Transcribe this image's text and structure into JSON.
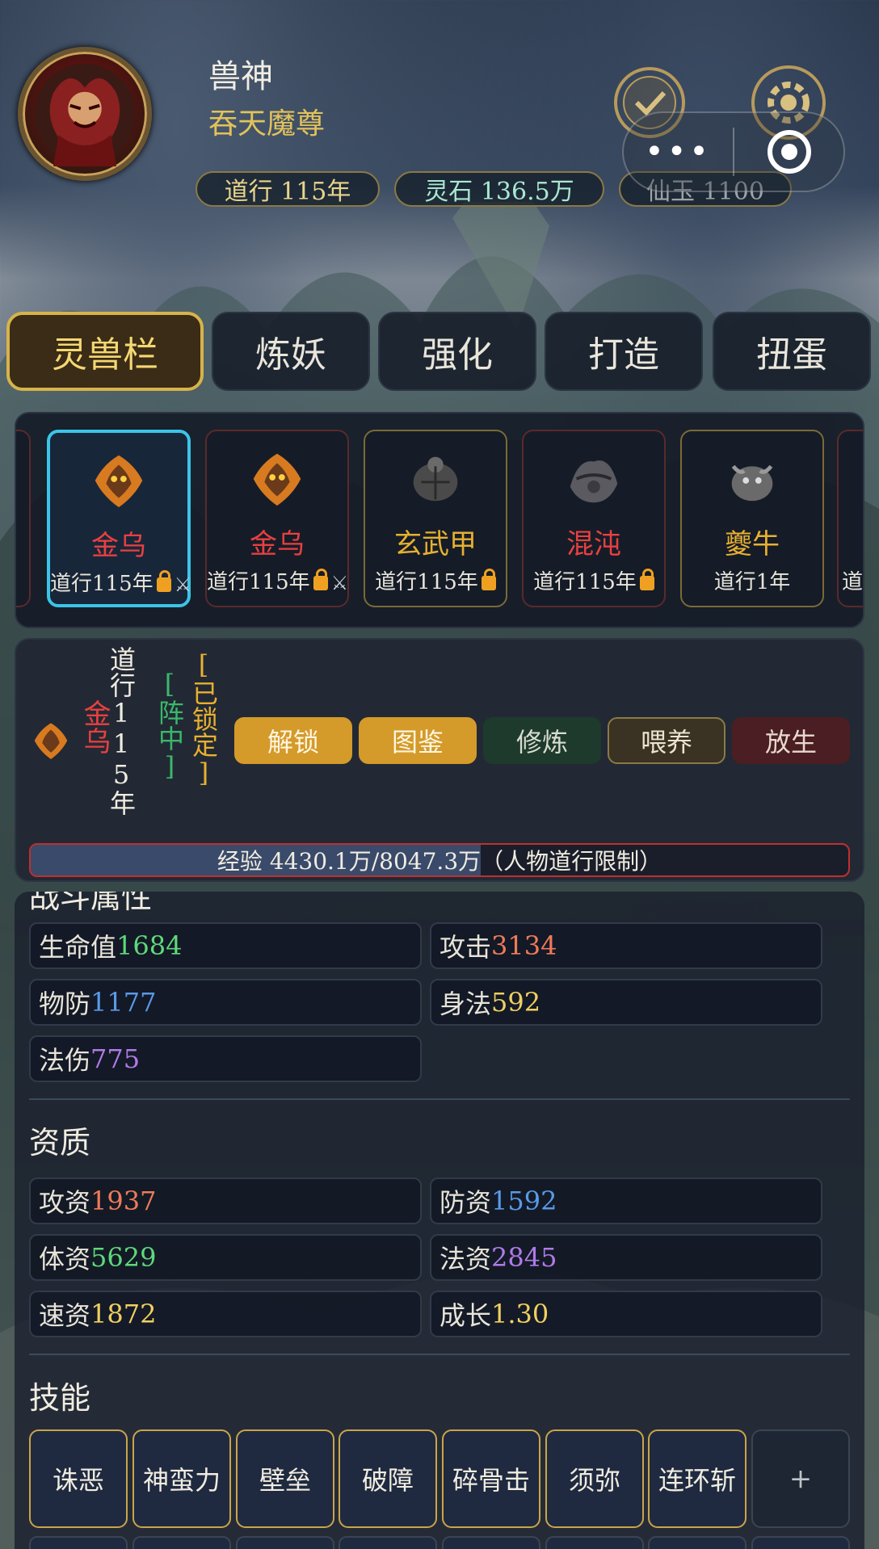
{
  "header": {
    "name": "兽神",
    "title": "吞天魔尊",
    "stats": [
      {
        "label": "道行 115年",
        "color": "#e8d48a"
      },
      {
        "label": "灵石 136.5万",
        "color": "#a8e8d0"
      },
      {
        "label": "仙玉 1100",
        "color": "#a0a4a8"
      }
    ],
    "icons": [
      "sign-in-icon",
      "settings-icon"
    ],
    "capsule": {
      "more_label": "•••",
      "close_label": "◉"
    }
  },
  "tabs": [
    {
      "label": "灵兽栏",
      "active": true
    },
    {
      "label": "炼妖",
      "active": false
    },
    {
      "label": "强化",
      "active": false
    },
    {
      "label": "打造",
      "active": false
    },
    {
      "label": "扭蛋",
      "active": false
    }
  ],
  "pets": [
    {
      "name": "金乌",
      "info": "道行115年",
      "locked": true,
      "battle": true,
      "name_color": "#e84040",
      "selected": true
    },
    {
      "name": "金乌",
      "info": "道行115年",
      "locked": true,
      "battle": true,
      "name_color": "#e84040",
      "selected": false
    },
    {
      "name": "玄武甲",
      "info": "道行115年",
      "locked": true,
      "battle": false,
      "name_color": "#e8b030",
      "selected": false
    },
    {
      "name": "混沌",
      "info": "道行115年",
      "locked": true,
      "battle": false,
      "name_color": "#e84040",
      "selected": false
    },
    {
      "name": "夔牛",
      "info": "道行1年",
      "locked": false,
      "battle": false,
      "name_color": "#e8b030",
      "selected": false
    },
    {
      "name": "",
      "info": "道行",
      "locked": false,
      "battle": false,
      "name_color": "#e8b030",
      "selected": false
    }
  ],
  "detail": {
    "name": "金乌",
    "dao": "道行115年",
    "formation": "[阵中]",
    "lock_state": "[已锁定]",
    "buttons": [
      {
        "label": "解锁",
        "bg": "#d49a2a",
        "fg": "#fff6e0"
      },
      {
        "label": "图鉴",
        "bg": "#d49a2a",
        "fg": "#fff6e0"
      },
      {
        "label": "修炼",
        "bg": "#1e3a2c",
        "fg": "#d8dcd0"
      },
      {
        "label": "喂养",
        "bg": "#3a3222",
        "fg": "#ece4d0"
      },
      {
        "label": "放生",
        "bg": "#4a1e22",
        "fg": "#e8d8d0"
      }
    ],
    "exp_text": "经验 4430.1万/8047.3万（人物道行限制）",
    "exp_progress": 0.55
  },
  "battle_attrs": {
    "title": "战斗属性",
    "items": [
      {
        "label": "生命值",
        "value": "1684",
        "color": "#5fd87a"
      },
      {
        "label": "攻击",
        "value": "3134",
        "color": "#f07a5a"
      },
      {
        "label": "物防",
        "value": "1177",
        "color": "#5a9ae8"
      },
      {
        "label": "身法",
        "value": "592",
        "color": "#f0d060"
      },
      {
        "label": "法伤",
        "value": "775",
        "color": "#b07ae8"
      }
    ]
  },
  "aptitude": {
    "title": "资质",
    "items": [
      {
        "label": "攻资",
        "value": "1937",
        "color": "#f07a5a"
      },
      {
        "label": "防资",
        "value": "1592",
        "color": "#5a9ae8"
      },
      {
        "label": "体资",
        "value": "5629",
        "color": "#5fd87a"
      },
      {
        "label": "法资",
        "value": "2845",
        "color": "#b07ae8"
      },
      {
        "label": "速资",
        "value": "1872",
        "color": "#f0d060"
      },
      {
        "label": "成长",
        "value": "1.30",
        "color": "#f0d060"
      }
    ]
  },
  "skills": {
    "title": "技能",
    "items": [
      "诛恶",
      "神蛮力",
      "壁垒",
      "破障",
      "碎骨击",
      "须弥",
      "连环斩"
    ],
    "add_label": "+"
  }
}
